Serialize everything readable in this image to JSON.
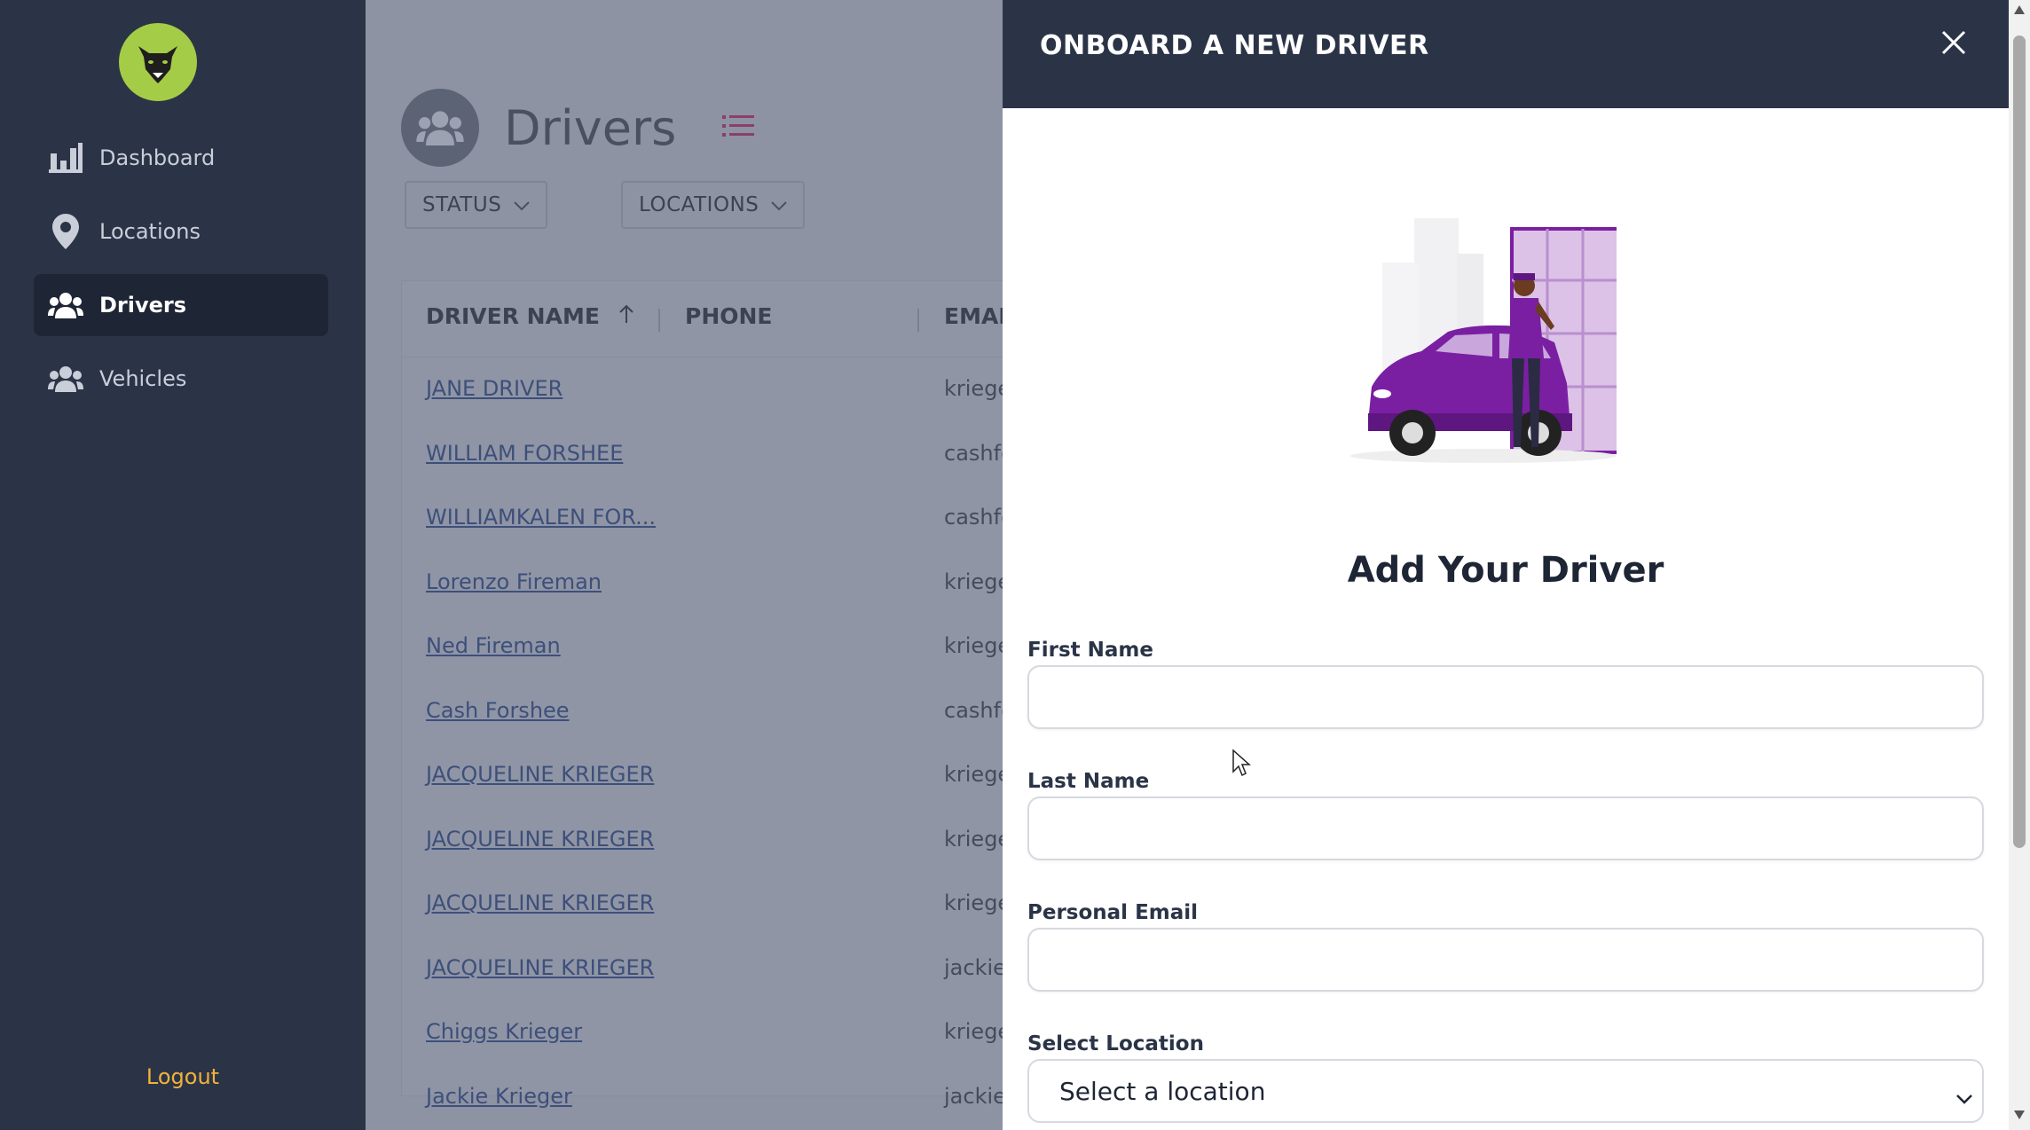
{
  "sidebar": {
    "items": [
      {
        "label": "Dashboard",
        "icon": "bar-chart-icon"
      },
      {
        "label": "Locations",
        "icon": "map-pin-icon"
      },
      {
        "label": "Drivers",
        "icon": "users-icon",
        "active": true
      },
      {
        "label": "Vehicles",
        "icon": "users-icon"
      }
    ],
    "logout": "Logout"
  },
  "main": {
    "title": "Drivers",
    "filters": [
      "STATUS",
      "LOCATIONS"
    ],
    "columns": [
      "DRIVER NAME",
      "PHONE",
      "EMAI"
    ],
    "rows": [
      {
        "name": "JANE DRIVER",
        "email": "kriege"
      },
      {
        "name": "WILLIAM FORSHEE",
        "email": "cashfo"
      },
      {
        "name": "WILLIAMKALEN FOR...",
        "email": "cashfo"
      },
      {
        "name": "Lorenzo Fireman",
        "email": "kriege"
      },
      {
        "name": "Ned Fireman",
        "email": "kriege"
      },
      {
        "name": "Cash Forshee",
        "email": "cashfo"
      },
      {
        "name": "JACQUELINE KRIEGER",
        "email": "kriege"
      },
      {
        "name": "JACQUELINE KRIEGER",
        "email": "kriege"
      },
      {
        "name": "JACQUELINE KRIEGER",
        "email": "kriege"
      },
      {
        "name": "JACQUELINE KRIEGER",
        "email": "jackie-"
      },
      {
        "name": "Chiggs Krieger",
        "email": "kriege"
      },
      {
        "name": "Jackie Krieger",
        "email": "jackie"
      }
    ]
  },
  "drawer": {
    "title": "ONBOARD A NEW DRIVER",
    "heading": "Add Your Driver",
    "fields": {
      "first_name": "First Name",
      "last_name": "Last Name",
      "email": "Personal Email",
      "location": "Select Location"
    },
    "location_value": "Select a location"
  },
  "colors": {
    "sidebar_bg": "#2b3447",
    "accent_logout": "#f2b23a",
    "logo_bg": "#a5cc46",
    "overlay_main": "#8d93a3",
    "purple": "#7a1fa2"
  }
}
